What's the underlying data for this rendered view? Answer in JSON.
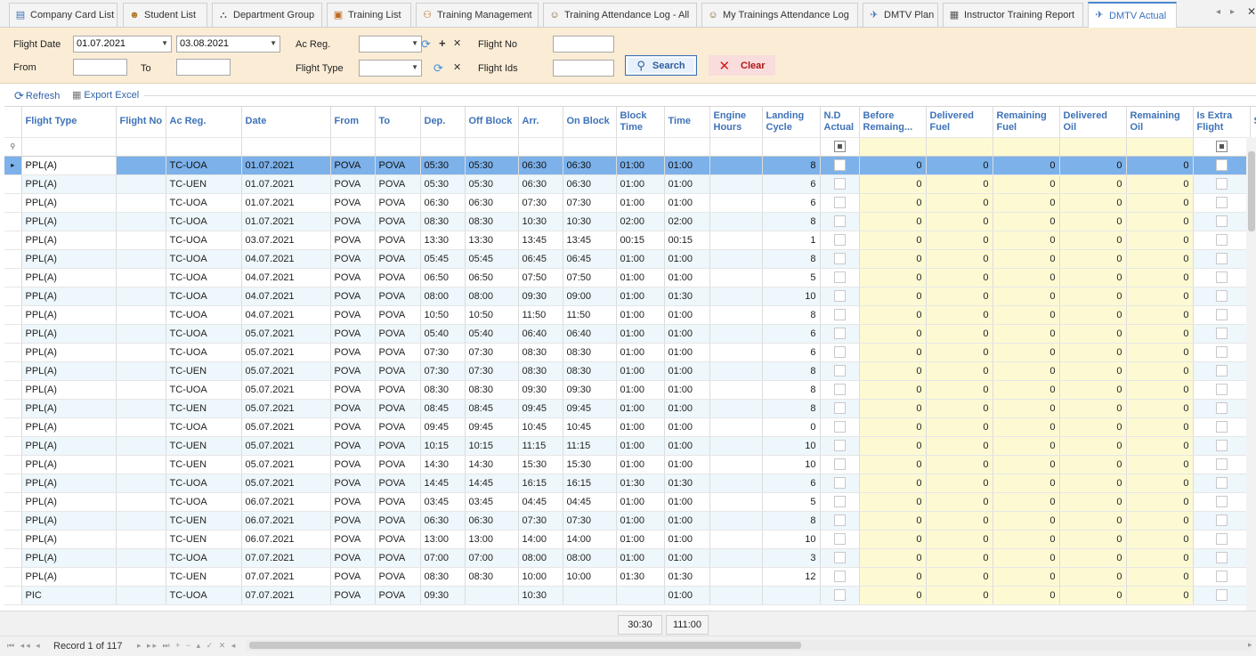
{
  "tabs": [
    {
      "label": "Company Card List",
      "icon": "company-card-icon"
    },
    {
      "label": "Student List",
      "icon": "student-icon"
    },
    {
      "label": "Department Group",
      "icon": "department-icon"
    },
    {
      "label": "Training List",
      "icon": "list-icon"
    },
    {
      "label": "Training Management",
      "icon": "training-icon"
    },
    {
      "label": "Training Attendance Log - All",
      "icon": "attendance-icon"
    },
    {
      "label": "My Trainings Attendance Log",
      "icon": "attendance-icon"
    },
    {
      "label": "DMTV Plan",
      "icon": "plane-icon"
    },
    {
      "label": "Instructor Training Report",
      "icon": "report-icon"
    },
    {
      "label": "DMTV Actual",
      "icon": "plane-icon",
      "active": true
    }
  ],
  "filter": {
    "flight_date_label": "Flight Date",
    "flight_date_from": "01.07.2021",
    "flight_date_to": "03.08.2021",
    "from_label": "From",
    "to_label": "To",
    "from_value": "",
    "to_value": "",
    "ac_reg_label": "Ac Reg.",
    "ac_reg_value": "",
    "flight_type_label": "Flight Type",
    "flight_type_value": "",
    "flight_no_label": "Flight No",
    "flight_no_value": "",
    "flight_ids_label": "Flight Ids",
    "flight_ids_value": "",
    "search_label": "Search",
    "clear_label": "Clear"
  },
  "toolbar": {
    "refresh_label": "Refresh",
    "export_label": "Export Excel"
  },
  "columns": [
    "Flight Type",
    "Flight No",
    "Ac Reg.",
    "Date",
    "From",
    "To",
    "Dep.",
    "Off Block",
    "Arr.",
    "On Block",
    "Block Time",
    "Time",
    "Engine Hours",
    "Landing Cycle",
    "N.D Actual",
    "Before Remaing...",
    "Delivered Fuel",
    "Remaining Fuel",
    "Delivered Oil",
    "Remaining Oil",
    "Is Extra Flight",
    "S"
  ],
  "rows": [
    {
      "type": "PPL(A)",
      "no": "",
      "reg": "TC-UOA",
      "date": "01.07.2021",
      "from": "POVA",
      "to": "POVA",
      "dep": "05:30",
      "off": "05:30",
      "arr": "06:30",
      "on": "06:30",
      "block": "01:00",
      "time": "01:00",
      "eng": "",
      "land": "8",
      "brem": "0",
      "dfuel": "0",
      "rfuel": "0",
      "doil": "0",
      "roil": "0"
    },
    {
      "type": "PPL(A)",
      "no": "",
      "reg": "TC-UEN",
      "date": "01.07.2021",
      "from": "POVA",
      "to": "POVA",
      "dep": "05:30",
      "off": "05:30",
      "arr": "06:30",
      "on": "06:30",
      "block": "01:00",
      "time": "01:00",
      "eng": "",
      "land": "6",
      "brem": "0",
      "dfuel": "0",
      "rfuel": "0",
      "doil": "0",
      "roil": "0"
    },
    {
      "type": "PPL(A)",
      "no": "",
      "reg": "TC-UOA",
      "date": "01.07.2021",
      "from": "POVA",
      "to": "POVA",
      "dep": "06:30",
      "off": "06:30",
      "arr": "07:30",
      "on": "07:30",
      "block": "01:00",
      "time": "01:00",
      "eng": "",
      "land": "6",
      "brem": "0",
      "dfuel": "0",
      "rfuel": "0",
      "doil": "0",
      "roil": "0"
    },
    {
      "type": "PPL(A)",
      "no": "",
      "reg": "TC-UOA",
      "date": "01.07.2021",
      "from": "POVA",
      "to": "POVA",
      "dep": "08:30",
      "off": "08:30",
      "arr": "10:30",
      "on": "10:30",
      "block": "02:00",
      "time": "02:00",
      "eng": "",
      "land": "8",
      "brem": "0",
      "dfuel": "0",
      "rfuel": "0",
      "doil": "0",
      "roil": "0"
    },
    {
      "type": "PPL(A)",
      "no": "",
      "reg": "TC-UOA",
      "date": "03.07.2021",
      "from": "POVA",
      "to": "POVA",
      "dep": "13:30",
      "off": "13:30",
      "arr": "13:45",
      "on": "13:45",
      "block": "00:15",
      "time": "00:15",
      "eng": "",
      "land": "1",
      "brem": "0",
      "dfuel": "0",
      "rfuel": "0",
      "doil": "0",
      "roil": "0"
    },
    {
      "type": "PPL(A)",
      "no": "",
      "reg": "TC-UOA",
      "date": "04.07.2021",
      "from": "POVA",
      "to": "POVA",
      "dep": "05:45",
      "off": "05:45",
      "arr": "06:45",
      "on": "06:45",
      "block": "01:00",
      "time": "01:00",
      "eng": "",
      "land": "8",
      "brem": "0",
      "dfuel": "0",
      "rfuel": "0",
      "doil": "0",
      "roil": "0"
    },
    {
      "type": "PPL(A)",
      "no": "",
      "reg": "TC-UOA",
      "date": "04.07.2021",
      "from": "POVA",
      "to": "POVA",
      "dep": "06:50",
      "off": "06:50",
      "arr": "07:50",
      "on": "07:50",
      "block": "01:00",
      "time": "01:00",
      "eng": "",
      "land": "5",
      "brem": "0",
      "dfuel": "0",
      "rfuel": "0",
      "doil": "0",
      "roil": "0"
    },
    {
      "type": "PPL(A)",
      "no": "",
      "reg": "TC-UOA",
      "date": "04.07.2021",
      "from": "POVA",
      "to": "POVA",
      "dep": "08:00",
      "off": "08:00",
      "arr": "09:30",
      "on": "09:00",
      "block": "01:00",
      "time": "01:30",
      "eng": "",
      "land": "10",
      "brem": "0",
      "dfuel": "0",
      "rfuel": "0",
      "doil": "0",
      "roil": "0"
    },
    {
      "type": "PPL(A)",
      "no": "",
      "reg": "TC-UOA",
      "date": "04.07.2021",
      "from": "POVA",
      "to": "POVA",
      "dep": "10:50",
      "off": "10:50",
      "arr": "11:50",
      "on": "11:50",
      "block": "01:00",
      "time": "01:00",
      "eng": "",
      "land": "8",
      "brem": "0",
      "dfuel": "0",
      "rfuel": "0",
      "doil": "0",
      "roil": "0"
    },
    {
      "type": "PPL(A)",
      "no": "",
      "reg": "TC-UOA",
      "date": "05.07.2021",
      "from": "POVA",
      "to": "POVA",
      "dep": "05:40",
      "off": "05:40",
      "arr": "06:40",
      "on": "06:40",
      "block": "01:00",
      "time": "01:00",
      "eng": "",
      "land": "6",
      "brem": "0",
      "dfuel": "0",
      "rfuel": "0",
      "doil": "0",
      "roil": "0"
    },
    {
      "type": "PPL(A)",
      "no": "",
      "reg": "TC-UOA",
      "date": "05.07.2021",
      "from": "POVA",
      "to": "POVA",
      "dep": "07:30",
      "off": "07:30",
      "arr": "08:30",
      "on": "08:30",
      "block": "01:00",
      "time": "01:00",
      "eng": "",
      "land": "6",
      "brem": "0",
      "dfuel": "0",
      "rfuel": "0",
      "doil": "0",
      "roil": "0"
    },
    {
      "type": "PPL(A)",
      "no": "",
      "reg": "TC-UEN",
      "date": "05.07.2021",
      "from": "POVA",
      "to": "POVA",
      "dep": "07:30",
      "off": "07:30",
      "arr": "08:30",
      "on": "08:30",
      "block": "01:00",
      "time": "01:00",
      "eng": "",
      "land": "8",
      "brem": "0",
      "dfuel": "0",
      "rfuel": "0",
      "doil": "0",
      "roil": "0"
    },
    {
      "type": "PPL(A)",
      "no": "",
      "reg": "TC-UOA",
      "date": "05.07.2021",
      "from": "POVA",
      "to": "POVA",
      "dep": "08:30",
      "off": "08:30",
      "arr": "09:30",
      "on": "09:30",
      "block": "01:00",
      "time": "01:00",
      "eng": "",
      "land": "8",
      "brem": "0",
      "dfuel": "0",
      "rfuel": "0",
      "doil": "0",
      "roil": "0"
    },
    {
      "type": "PPL(A)",
      "no": "",
      "reg": "TC-UEN",
      "date": "05.07.2021",
      "from": "POVA",
      "to": "POVA",
      "dep": "08:45",
      "off": "08:45",
      "arr": "09:45",
      "on": "09:45",
      "block": "01:00",
      "time": "01:00",
      "eng": "",
      "land": "8",
      "brem": "0",
      "dfuel": "0",
      "rfuel": "0",
      "doil": "0",
      "roil": "0"
    },
    {
      "type": "PPL(A)",
      "no": "",
      "reg": "TC-UOA",
      "date": "05.07.2021",
      "from": "POVA",
      "to": "POVA",
      "dep": "09:45",
      "off": "09:45",
      "arr": "10:45",
      "on": "10:45",
      "block": "01:00",
      "time": "01:00",
      "eng": "",
      "land": "0",
      "brem": "0",
      "dfuel": "0",
      "rfuel": "0",
      "doil": "0",
      "roil": "0"
    },
    {
      "type": "PPL(A)",
      "no": "",
      "reg": "TC-UEN",
      "date": "05.07.2021",
      "from": "POVA",
      "to": "POVA",
      "dep": "10:15",
      "off": "10:15",
      "arr": "11:15",
      "on": "11:15",
      "block": "01:00",
      "time": "01:00",
      "eng": "",
      "land": "10",
      "brem": "0",
      "dfuel": "0",
      "rfuel": "0",
      "doil": "0",
      "roil": "0"
    },
    {
      "type": "PPL(A)",
      "no": "",
      "reg": "TC-UEN",
      "date": "05.07.2021",
      "from": "POVA",
      "to": "POVA",
      "dep": "14:30",
      "off": "14:30",
      "arr": "15:30",
      "on": "15:30",
      "block": "01:00",
      "time": "01:00",
      "eng": "",
      "land": "10",
      "brem": "0",
      "dfuel": "0",
      "rfuel": "0",
      "doil": "0",
      "roil": "0"
    },
    {
      "type": "PPL(A)",
      "no": "",
      "reg": "TC-UOA",
      "date": "05.07.2021",
      "from": "POVA",
      "to": "POVA",
      "dep": "14:45",
      "off": "14:45",
      "arr": "16:15",
      "on": "16:15",
      "block": "01:30",
      "time": "01:30",
      "eng": "",
      "land": "6",
      "brem": "0",
      "dfuel": "0",
      "rfuel": "0",
      "doil": "0",
      "roil": "0"
    },
    {
      "type": "PPL(A)",
      "no": "",
      "reg": "TC-UOA",
      "date": "06.07.2021",
      "from": "POVA",
      "to": "POVA",
      "dep": "03:45",
      "off": "03:45",
      "arr": "04:45",
      "on": "04:45",
      "block": "01:00",
      "time": "01:00",
      "eng": "",
      "land": "5",
      "brem": "0",
      "dfuel": "0",
      "rfuel": "0",
      "doil": "0",
      "roil": "0"
    },
    {
      "type": "PPL(A)",
      "no": "",
      "reg": "TC-UEN",
      "date": "06.07.2021",
      "from": "POVA",
      "to": "POVA",
      "dep": "06:30",
      "off": "06:30",
      "arr": "07:30",
      "on": "07:30",
      "block": "01:00",
      "time": "01:00",
      "eng": "",
      "land": "8",
      "brem": "0",
      "dfuel": "0",
      "rfuel": "0",
      "doil": "0",
      "roil": "0"
    },
    {
      "type": "PPL(A)",
      "no": "",
      "reg": "TC-UEN",
      "date": "06.07.2021",
      "from": "POVA",
      "to": "POVA",
      "dep": "13:00",
      "off": "13:00",
      "arr": "14:00",
      "on": "14:00",
      "block": "01:00",
      "time": "01:00",
      "eng": "",
      "land": "10",
      "brem": "0",
      "dfuel": "0",
      "rfuel": "0",
      "doil": "0",
      "roil": "0"
    },
    {
      "type": "PPL(A)",
      "no": "",
      "reg": "TC-UOA",
      "date": "07.07.2021",
      "from": "POVA",
      "to": "POVA",
      "dep": "07:00",
      "off": "07:00",
      "arr": "08:00",
      "on": "08:00",
      "block": "01:00",
      "time": "01:00",
      "eng": "",
      "land": "3",
      "brem": "0",
      "dfuel": "0",
      "rfuel": "0",
      "doil": "0",
      "roil": "0"
    },
    {
      "type": "PPL(A)",
      "no": "",
      "reg": "TC-UEN",
      "date": "07.07.2021",
      "from": "POVA",
      "to": "POVA",
      "dep": "08:30",
      "off": "08:30",
      "arr": "10:00",
      "on": "10:00",
      "block": "01:30",
      "time": "01:30",
      "eng": "",
      "land": "12",
      "brem": "0",
      "dfuel": "0",
      "rfuel": "0",
      "doil": "0",
      "roil": "0"
    },
    {
      "type": "PIC",
      "no": "",
      "reg": "TC-UOA",
      "date": "07.07.2021",
      "from": "POVA",
      "to": "POVA",
      "dep": "09:30",
      "off": "",
      "arr": "10:30",
      "on": "",
      "block": "",
      "time": "01:00",
      "eng": "",
      "land": "",
      "brem": "0",
      "dfuel": "0",
      "rfuel": "0",
      "doil": "0",
      "roil": "0"
    }
  ],
  "totals": {
    "block_time": "30:30",
    "time": "111:00"
  },
  "navigator": {
    "record_text": "Record 1 of 117"
  }
}
